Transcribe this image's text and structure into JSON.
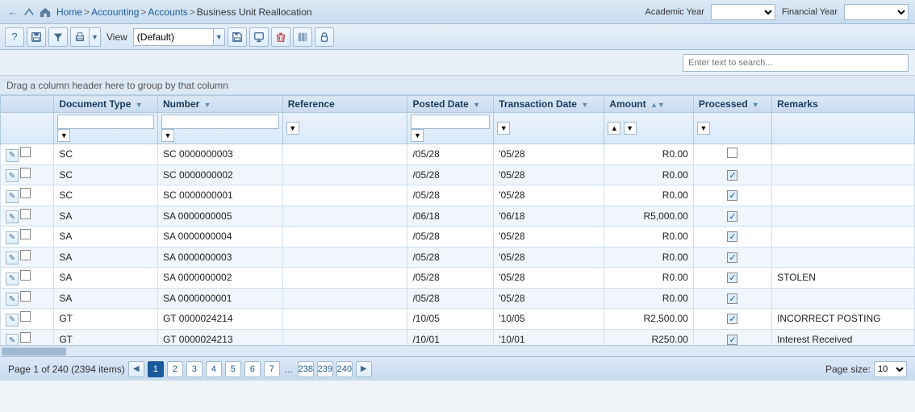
{
  "topbar": {
    "home": "Home",
    "accounting": "Accounting",
    "accounts": "Accounts",
    "current": "Business Unit Reallocation",
    "academic_year_label": "Academic Year",
    "financial_year_label": "Financial Year"
  },
  "toolbar": {
    "view_label": "View",
    "view_option": "(Default)"
  },
  "search": {
    "placeholder": "Enter text to search..."
  },
  "group_header": "Drag a column header here to group by that column",
  "columns": {
    "doc_type": "Document Type",
    "number": "Number",
    "reference": "Reference",
    "posted_date": "Posted Date",
    "transaction_date": "Transaction Date",
    "amount": "Amount",
    "processed": "Processed",
    "remarks": "Remarks"
  },
  "rows": [
    {
      "doc_type": "SC",
      "number": "SC 0000000003",
      "reference": "",
      "posted_date": "/05/28",
      "transaction_date": "'05/28",
      "amount": "R0.00",
      "processed": false,
      "remarks": ""
    },
    {
      "doc_type": "SC",
      "number": "SC 0000000002",
      "reference": "",
      "posted_date": "/05/28",
      "transaction_date": "'05/28",
      "amount": "R0.00",
      "processed": true,
      "remarks": ""
    },
    {
      "doc_type": "SC",
      "number": "SC 0000000001",
      "reference": "",
      "posted_date": "/05/28",
      "transaction_date": "'05/28",
      "amount": "R0.00",
      "processed": true,
      "remarks": ""
    },
    {
      "doc_type": "SA",
      "number": "SA 0000000005",
      "reference": "",
      "posted_date": "/06/18",
      "transaction_date": "'06/18",
      "amount": "R5,000.00",
      "processed": true,
      "remarks": ""
    },
    {
      "doc_type": "SA",
      "number": "SA 0000000004",
      "reference": "",
      "posted_date": "/05/28",
      "transaction_date": "'05/28",
      "amount": "R0.00",
      "processed": true,
      "remarks": ""
    },
    {
      "doc_type": "SA",
      "number": "SA 0000000003",
      "reference": "",
      "posted_date": "/05/28",
      "transaction_date": "'05/28",
      "amount": "R0.00",
      "processed": true,
      "remarks": ""
    },
    {
      "doc_type": "SA",
      "number": "SA 0000000002",
      "reference": "",
      "posted_date": "/05/28",
      "transaction_date": "'05/28",
      "amount": "R0.00",
      "processed": true,
      "remarks": "STOLEN"
    },
    {
      "doc_type": "SA",
      "number": "SA 0000000001",
      "reference": "",
      "posted_date": "/05/28",
      "transaction_date": "'05/28",
      "amount": "R0.00",
      "processed": true,
      "remarks": ""
    },
    {
      "doc_type": "GT",
      "number": "GT 0000024214",
      "reference": "",
      "posted_date": "/10/05",
      "transaction_date": "'10/05",
      "amount": "R2,500.00",
      "processed": true,
      "remarks": "INCORRECT POSTING"
    },
    {
      "doc_type": "GT",
      "number": "GT 0000024213",
      "reference": "",
      "posted_date": "/10/01",
      "transaction_date": "'10/01",
      "amount": "R250.00",
      "processed": true,
      "remarks": "Interest Received"
    }
  ],
  "pagination": {
    "page_info": "Page 1 of 240 (2394 items)",
    "current_page": "1",
    "pages": [
      "1",
      "2",
      "3",
      "4",
      "5",
      "6",
      "7",
      "238",
      "239",
      "240"
    ],
    "page_size_label": "Page size:",
    "page_size": "10"
  }
}
